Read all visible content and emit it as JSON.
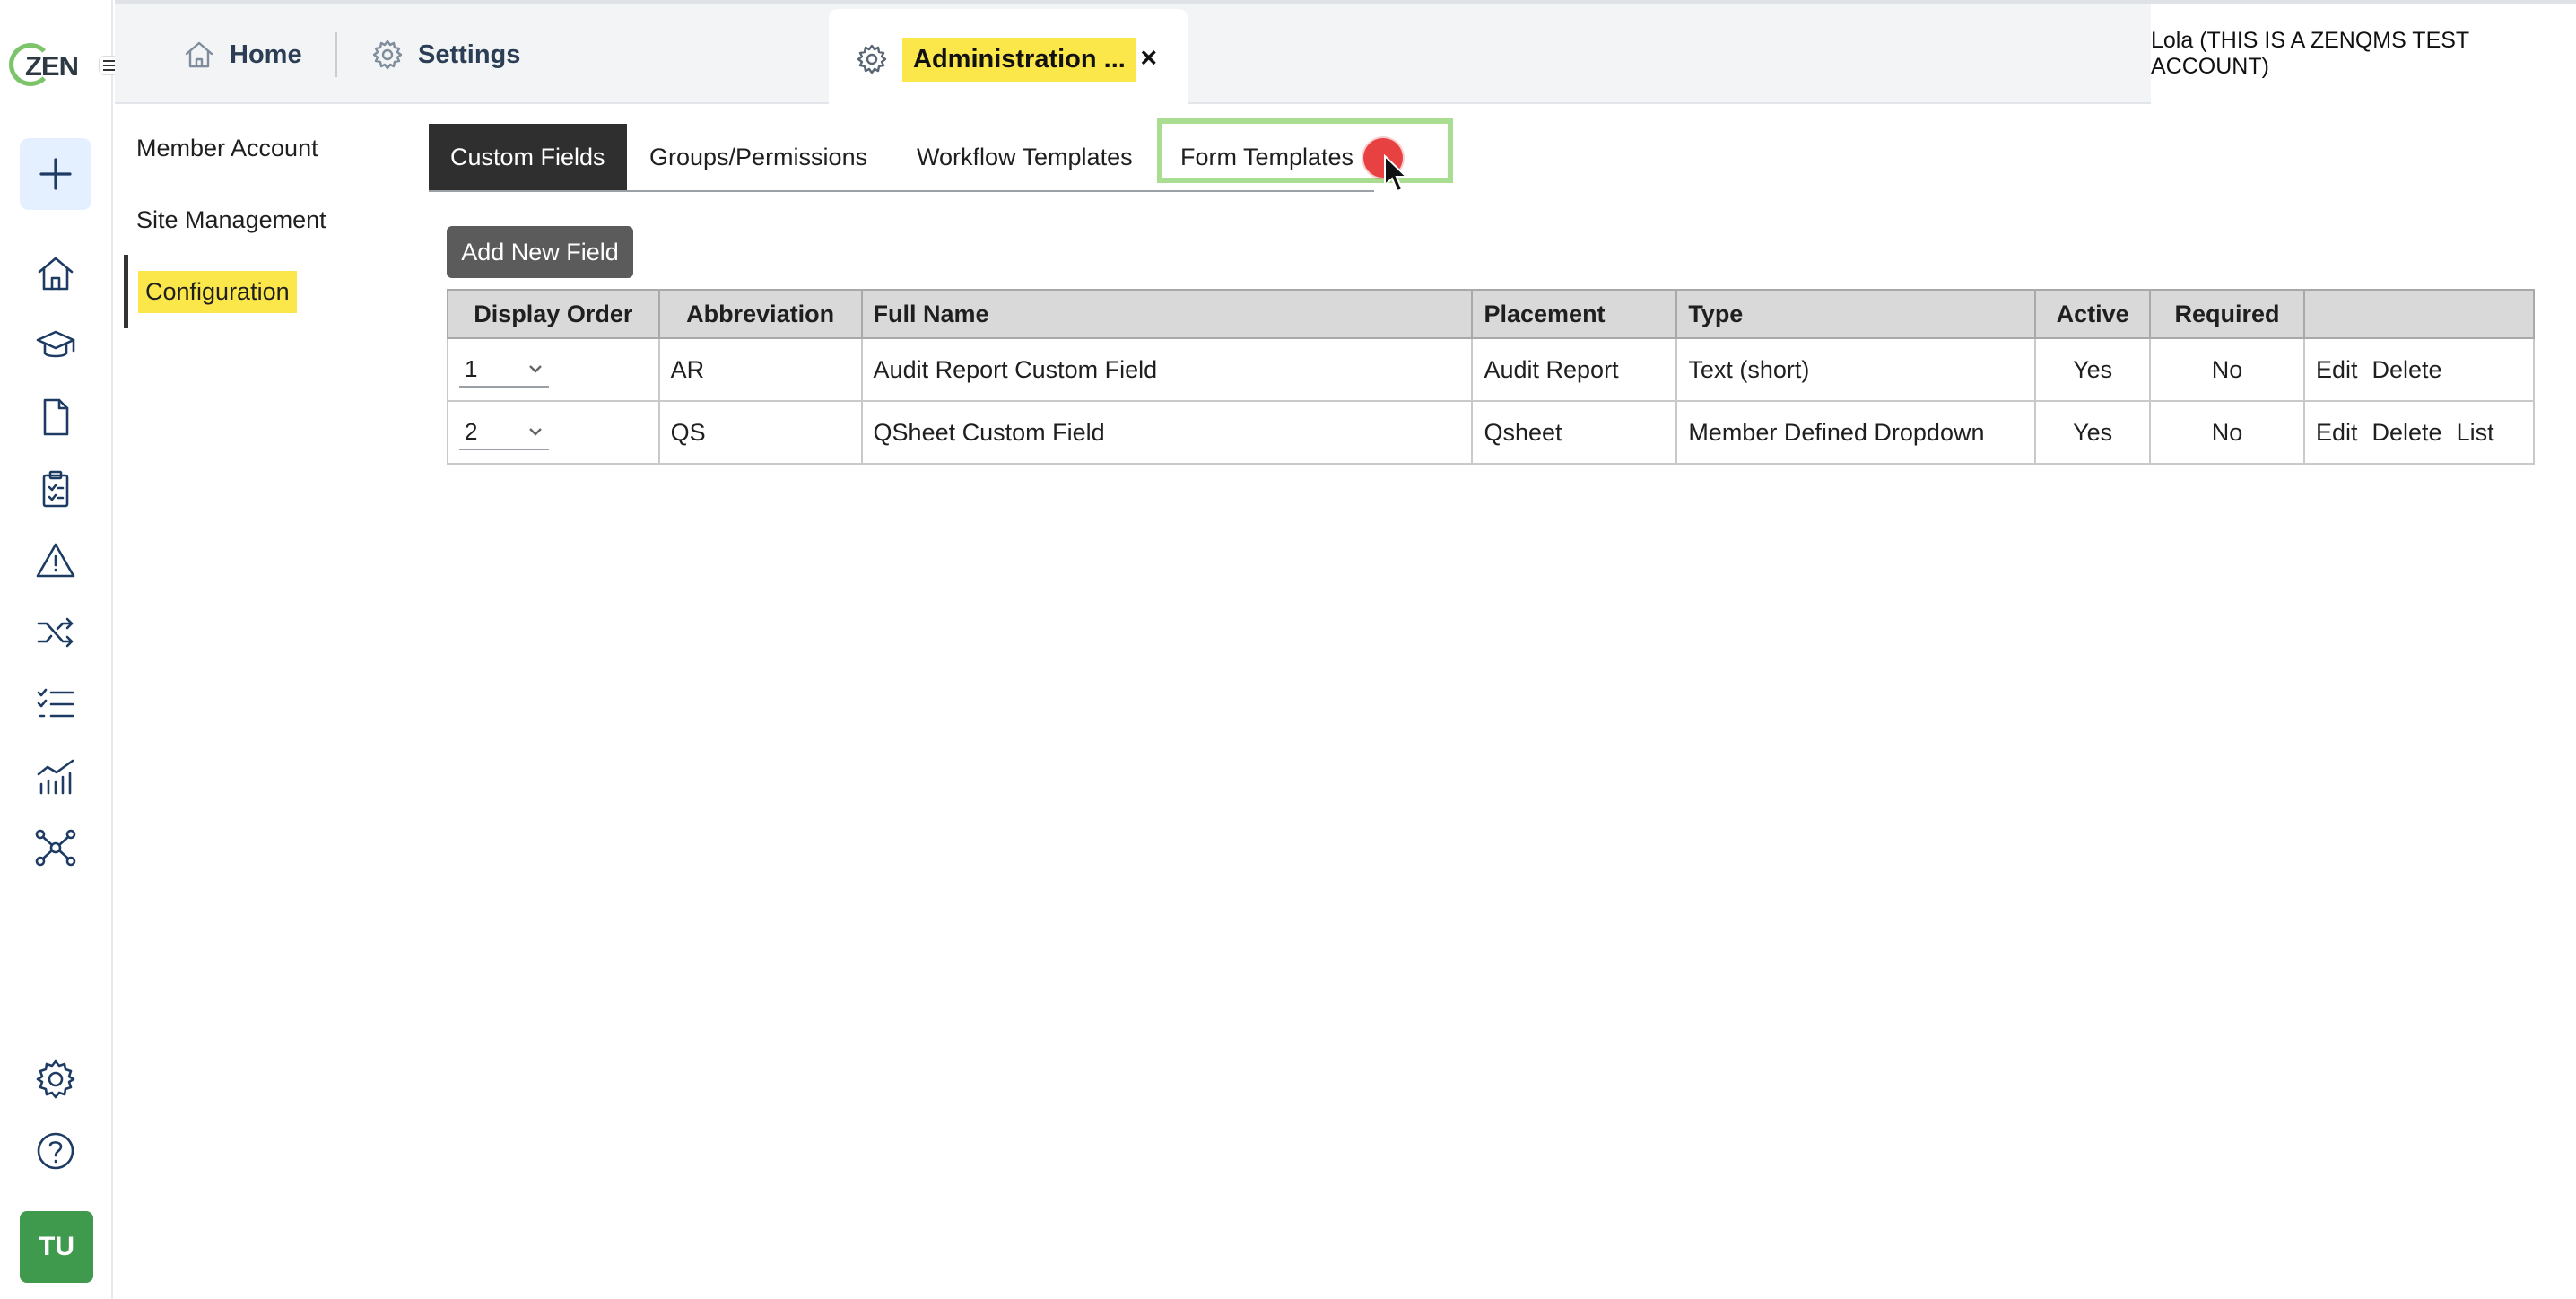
{
  "logo": {
    "text": "ZEN"
  },
  "top_tabs": {
    "home": "Home",
    "settings": "Settings",
    "active": "Administration ...",
    "close": "×"
  },
  "account": "Lola (THIS IS A ZENQMS TEST ACCOUNT)",
  "avatar": "TU",
  "subnav": {
    "items": [
      "Member Account",
      "Site Management",
      "Configuration"
    ],
    "active": "Configuration"
  },
  "content_tabs": [
    "Custom Fields",
    "Groups/Permissions",
    "Workflow Templates",
    "Form Templates"
  ],
  "active_content_tab": "Custom Fields",
  "add_button": "Add New Field",
  "table": {
    "headers": [
      "Display Order",
      "Abbreviation",
      "Full Name",
      "Placement",
      "Type",
      "Active",
      "Required",
      ""
    ],
    "rows": [
      {
        "order": "1",
        "abbreviation": "AR",
        "full_name": "Audit Report Custom Field",
        "placement": "Audit Report",
        "type": "Text (short)",
        "active": "Yes",
        "required": "No",
        "actions": [
          "Edit",
          "Delete"
        ]
      },
      {
        "order": "2",
        "abbreviation": "QS",
        "full_name": "QSheet Custom Field",
        "placement": "Qsheet",
        "type": "Member Defined Dropdown",
        "active": "Yes",
        "required": "No",
        "actions": [
          "Edit",
          "Delete",
          "List"
        ]
      }
    ]
  },
  "rail_icons": [
    "home-icon",
    "training-cap-icon",
    "document-icon",
    "clipboard-icon",
    "warning-icon",
    "shuffle-icon",
    "checklist-icon",
    "analytics-icon",
    "network-icon",
    "gear-icon",
    "help-icon"
  ],
  "colors": {
    "highlight": "#fbe74a",
    "link": "#1a4f8b",
    "avatar": "#3f9a4e",
    "tab_active": "#2f2f2f"
  }
}
